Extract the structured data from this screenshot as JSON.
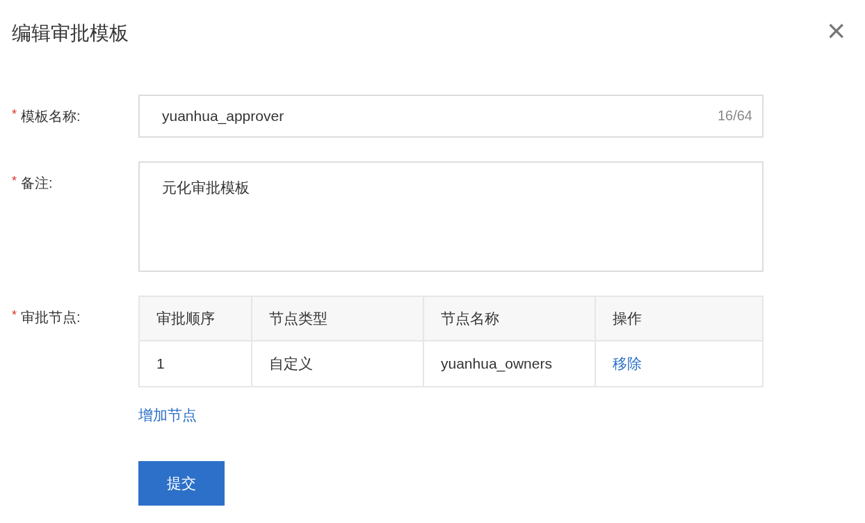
{
  "dialog": {
    "title": "编辑审批模板",
    "close": "×"
  },
  "fields": [
    {
      "kind": "input",
      "label": "模板名称:",
      "required": true,
      "required_mark": "*",
      "value": "yuanhua_approver",
      "counter": "16/64"
    },
    {
      "kind": "textarea",
      "label": "备注:",
      "required": true,
      "required_mark": "*",
      "value": "元化审批模板"
    },
    {
      "kind": "table",
      "label": "审批节点:",
      "required": true,
      "required_mark": "*",
      "columns": [
        "审批顺序",
        "节点类型",
        "节点名称",
        "操作"
      ],
      "rows": [
        {
          "cells": [
            "1",
            "自定义",
            "yuanhua_owners"
          ],
          "action": "移除"
        }
      ],
      "add_link": "增加节点"
    }
  ],
  "submit": "提交"
}
